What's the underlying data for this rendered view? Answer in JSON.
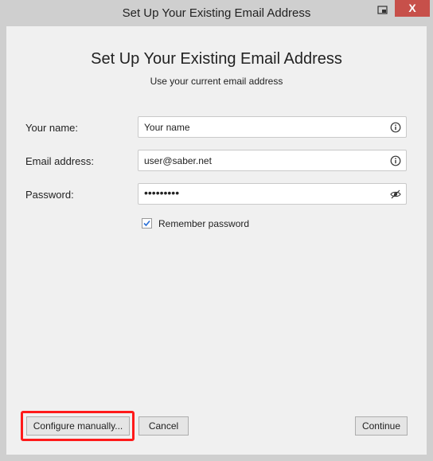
{
  "window": {
    "title": "Set Up Your Existing Email Address",
    "close_glyph": "X"
  },
  "header": {
    "heading": "Set Up Your Existing Email Address",
    "subheading": "Use your current email address"
  },
  "form": {
    "name_label": "Your name:",
    "name_value": "Your name",
    "email_label": "Email address:",
    "email_value": "user@saber.net",
    "password_label": "Password:",
    "password_value": "•••••••••",
    "remember_label": "Remember password",
    "remember_checked": true
  },
  "buttons": {
    "configure_label": "Configure manually...",
    "cancel_label": "Cancel",
    "continue_label": "Continue"
  },
  "colors": {
    "highlight": "#ff1a1a",
    "close_button": "#c7504a"
  },
  "icons": {
    "name_field": "info-icon",
    "email_field": "info-icon",
    "password_field": "eye-slash-icon",
    "title": "window-mode-icon"
  }
}
